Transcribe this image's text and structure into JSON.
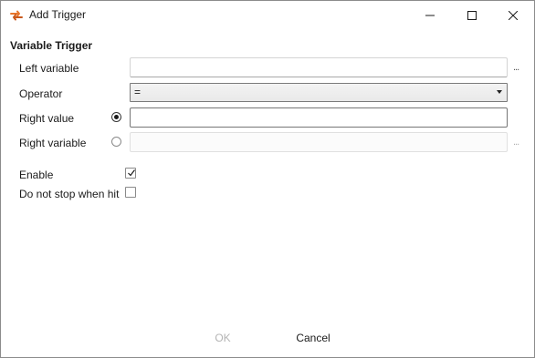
{
  "window": {
    "title": "Add Trigger"
  },
  "section": {
    "title": "Variable Trigger"
  },
  "form": {
    "left_variable_label": "Left variable",
    "left_variable_value": "",
    "left_variable_browse": "...",
    "operator_label": "Operator",
    "operator_value": "=",
    "right_value_label": "Right value",
    "right_value_value": "",
    "right_value_selected": true,
    "right_variable_label": "Right variable",
    "right_variable_value": "",
    "right_variable_browse": "...",
    "right_variable_selected": false,
    "enable_label": "Enable",
    "enable_checked": true,
    "dont_stop_label": "Do not stop when hit",
    "dont_stop_checked": false
  },
  "buttons": {
    "ok": "OK",
    "cancel": "Cancel"
  },
  "icons": {
    "app": "arrow-exchange-icon",
    "minimize": "minimize-icon",
    "maximize": "maximize-icon",
    "close": "close-icon"
  },
  "colors": {
    "app_icon": "#e8762b"
  }
}
